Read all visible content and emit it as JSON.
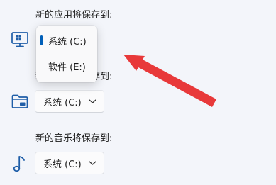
{
  "sections": [
    {
      "label": "新的应用将保存到:",
      "icon": "monitor-icon",
      "value": "系统 (C:)"
    },
    {
      "label": "新的文档将保存到:",
      "icon": "folder-icon",
      "value": "系统 (C:)"
    },
    {
      "label": "新的音乐将保存到:",
      "icon": "music-note-icon",
      "value": "系统 (C:)"
    }
  ],
  "popup": {
    "options": [
      {
        "label": "系统 (C:)",
        "selected": true
      },
      {
        "label": "软件 (E:)",
        "selected": false
      }
    ]
  },
  "colors": {
    "accent": "#005fb8",
    "annotation_arrow": "#e8393a",
    "background": "#f3f5fa"
  }
}
